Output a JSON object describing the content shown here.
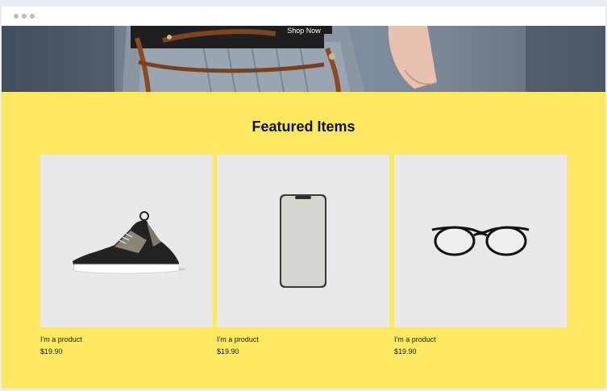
{
  "hero": {
    "cta_label": "Shop Now"
  },
  "featured": {
    "title": "Featured Items",
    "products": [
      {
        "name": "I'm a product",
        "price": "$19.90",
        "icon": "sneaker-icon"
      },
      {
        "name": "I'm a product",
        "price": "$19.90",
        "icon": "smartphone-icon"
      },
      {
        "name": "I'm a product",
        "price": "$19.90",
        "icon": "eyeglasses-icon"
      }
    ]
  },
  "colors": {
    "section_bg": "#fee862",
    "card_bg": "#e9e9eb",
    "button_bg": "#1d1d1d"
  }
}
